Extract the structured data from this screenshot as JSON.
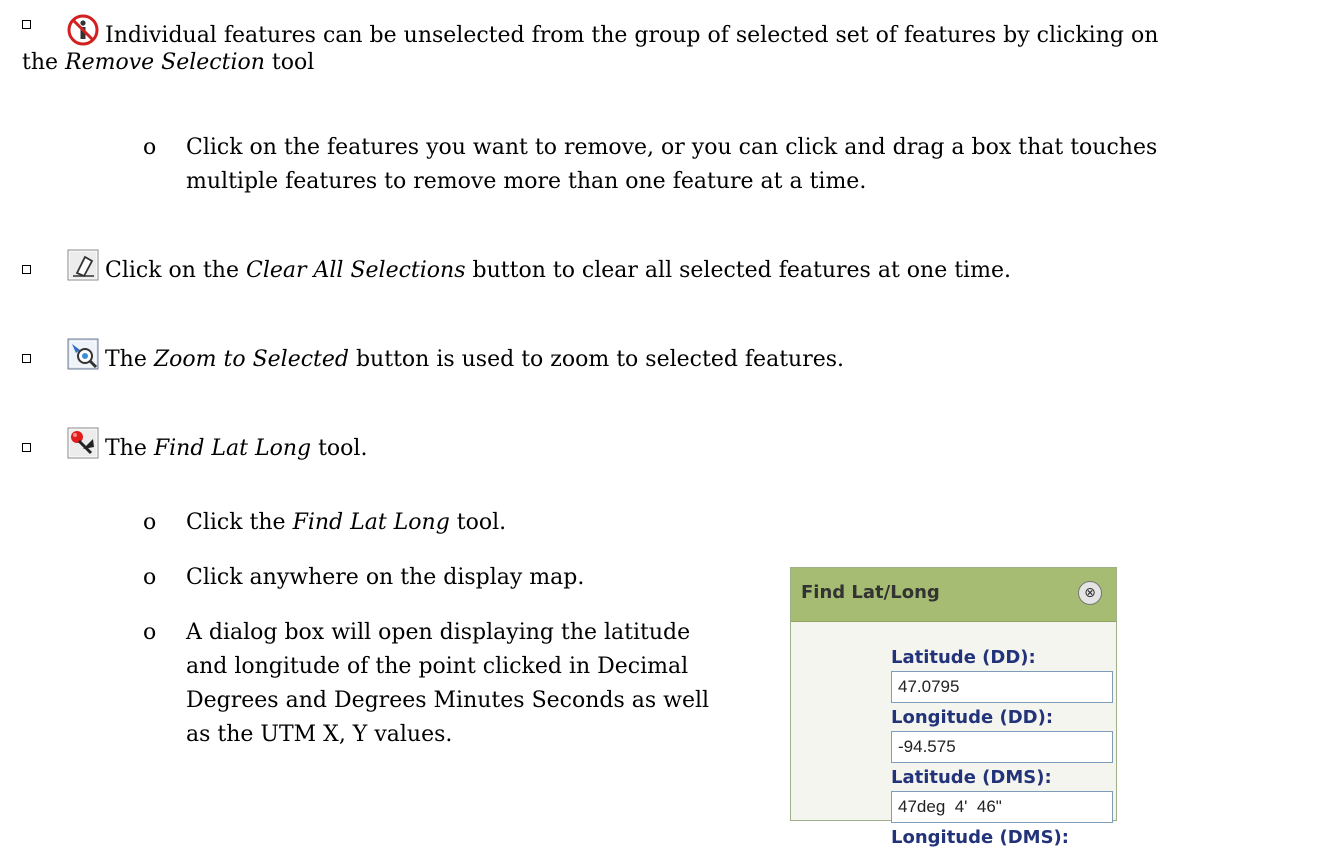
{
  "items": {
    "remove": {
      "icon": "remove-selection-icon",
      "before": "Individual features can be unselected from the group of selected set of features by clicking on",
      "line2_before": "the ",
      "emph": "Remove Selection",
      "after": " tool",
      "sub": "Click on the features you want to remove, or you can click and drag a box that touches",
      "sub_line2": "multiple features to remove more than one feature at a time."
    },
    "clear": {
      "icon": "clear-all-selections-icon",
      "before": "Click on the ",
      "emph": "Clear All Selections",
      "after": " button to clear all selected features at one time."
    },
    "zoom": {
      "icon": "zoom-to-selected-icon",
      "before": "The ",
      "emph": "Zoom to Selected",
      "after": " button is used to zoom to selected features."
    },
    "findlatlong": {
      "icon": "find-lat-long-icon",
      "before": "The ",
      "emph": "Find Lat Long",
      "after": " tool.",
      "sub1_before": "Click the ",
      "sub1_emph": "Find Lat Long",
      "sub1_after": " tool.",
      "sub2": "Click anywhere on the display map.",
      "sub3_lines": [
        "A dialog box will open displaying the latitude",
        "and longitude of the point clicked in Decimal",
        "Degrees and Degrees Minutes Seconds as well",
        "as the UTM X, Y values."
      ]
    }
  },
  "bullet_marker": "o",
  "dialog": {
    "title": "Find Lat/Long",
    "close_glyph": "⊗",
    "fields": [
      {
        "label": "Latitude (DD):",
        "value": "47.0795"
      },
      {
        "label": "Longitude (DD):",
        "value": "-94.575"
      },
      {
        "label": "Latitude (DMS):",
        "value": "47deg  4'  46\""
      },
      {
        "label": "Longitude (DMS):",
        "value": ""
      }
    ]
  },
  "colors": {
    "dialog_header": "#a6bc72",
    "dialog_label": "#22337a"
  }
}
